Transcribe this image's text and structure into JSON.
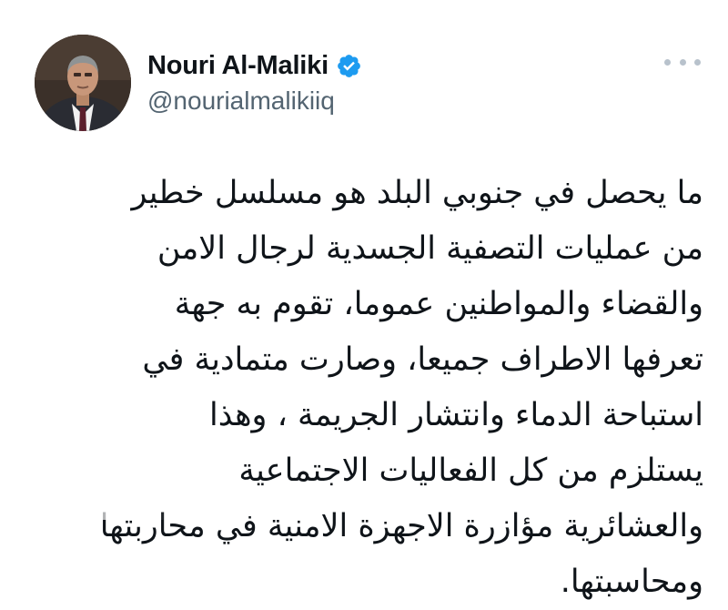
{
  "author": {
    "display_name": "Nouri Al-Maliki",
    "handle": "@nourialmalikiiq",
    "verified": true,
    "verified_icon": "verified-badge-icon",
    "avatar": "profile-photo"
  },
  "menu": {
    "icon": "more-options-icon"
  },
  "tweet": {
    "lines": [
      "ما يحصل في جنوبي البلد هو مسلسل خطير",
      "من عمليات التصفية الجسدية لرجال الامن",
      "والقضاء والمواطنين عموما، تقوم به جهة",
      "تعرفها الاطراف جميعا، وصارت متمادية في",
      "استباحة الدماء وانتشار الجريمة ، وهذا",
      "يستلزم من كل الفعاليات الاجتماعية",
      "والعشائرية مؤازرة الاجهزة الامنية في محاربتها",
      "ومحاسبتها."
    ]
  },
  "colors": {
    "text": "#0f1419",
    "handle": "#536471",
    "verified": "#1d9bf0",
    "dots": "#b8c2cc"
  }
}
